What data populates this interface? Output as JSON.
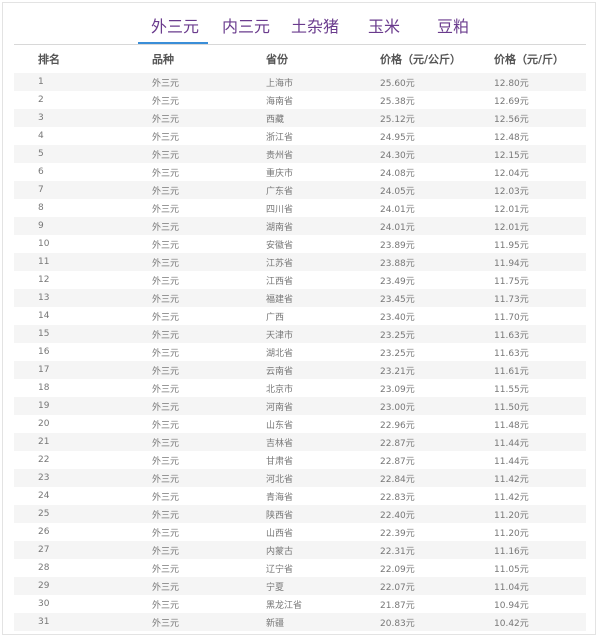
{
  "tabs": [
    {
      "label": "外三元",
      "active": true
    },
    {
      "label": "内三元",
      "active": false
    },
    {
      "label": "土杂猪",
      "active": false
    },
    {
      "label": "玉米",
      "active": false
    },
    {
      "label": "豆粕",
      "active": false
    }
  ],
  "table": {
    "headers": [
      "排名",
      "品种",
      "省份",
      "价格（元/公斤）",
      "价格（元/斤）"
    ],
    "rows": [
      [
        "1",
        "外三元",
        "上海市",
        "25.60元",
        "12.80元"
      ],
      [
        "2",
        "外三元",
        "海南省",
        "25.38元",
        "12.69元"
      ],
      [
        "3",
        "外三元",
        "西藏",
        "25.12元",
        "12.56元"
      ],
      [
        "4",
        "外三元",
        "浙江省",
        "24.95元",
        "12.48元"
      ],
      [
        "5",
        "外三元",
        "贵州省",
        "24.30元",
        "12.15元"
      ],
      [
        "6",
        "外三元",
        "重庆市",
        "24.08元",
        "12.04元"
      ],
      [
        "7",
        "外三元",
        "广东省",
        "24.05元",
        "12.03元"
      ],
      [
        "8",
        "外三元",
        "四川省",
        "24.01元",
        "12.01元"
      ],
      [
        "9",
        "外三元",
        "湖南省",
        "24.01元",
        "12.01元"
      ],
      [
        "10",
        "外三元",
        "安徽省",
        "23.89元",
        "11.95元"
      ],
      [
        "11",
        "外三元",
        "江苏省",
        "23.88元",
        "11.94元"
      ],
      [
        "12",
        "外三元",
        "江西省",
        "23.49元",
        "11.75元"
      ],
      [
        "13",
        "外三元",
        "福建省",
        "23.45元",
        "11.73元"
      ],
      [
        "14",
        "外三元",
        "广西",
        "23.40元",
        "11.70元"
      ],
      [
        "15",
        "外三元",
        "天津市",
        "23.25元",
        "11.63元"
      ],
      [
        "16",
        "外三元",
        "湖北省",
        "23.25元",
        "11.63元"
      ],
      [
        "17",
        "外三元",
        "云南省",
        "23.21元",
        "11.61元"
      ],
      [
        "18",
        "外三元",
        "北京市",
        "23.09元",
        "11.55元"
      ],
      [
        "19",
        "外三元",
        "河南省",
        "23.00元",
        "11.50元"
      ],
      [
        "20",
        "外三元",
        "山东省",
        "22.96元",
        "11.48元"
      ],
      [
        "21",
        "外三元",
        "吉林省",
        "22.87元",
        "11.44元"
      ],
      [
        "22",
        "外三元",
        "甘肃省",
        "22.87元",
        "11.44元"
      ],
      [
        "23",
        "外三元",
        "河北省",
        "22.84元",
        "11.42元"
      ],
      [
        "24",
        "外三元",
        "青海省",
        "22.83元",
        "11.42元"
      ],
      [
        "25",
        "外三元",
        "陕西省",
        "22.40元",
        "11.20元"
      ],
      [
        "26",
        "外三元",
        "山西省",
        "22.39元",
        "11.20元"
      ],
      [
        "27",
        "外三元",
        "内蒙古",
        "22.31元",
        "11.16元"
      ],
      [
        "28",
        "外三元",
        "辽宁省",
        "22.09元",
        "11.05元"
      ],
      [
        "29",
        "外三元",
        "宁夏",
        "22.07元",
        "11.04元"
      ],
      [
        "30",
        "外三元",
        "黑龙江省",
        "21.87元",
        "10.94元"
      ],
      [
        "31",
        "外三元",
        "新疆",
        "20.83元",
        "10.42元"
      ]
    ]
  }
}
